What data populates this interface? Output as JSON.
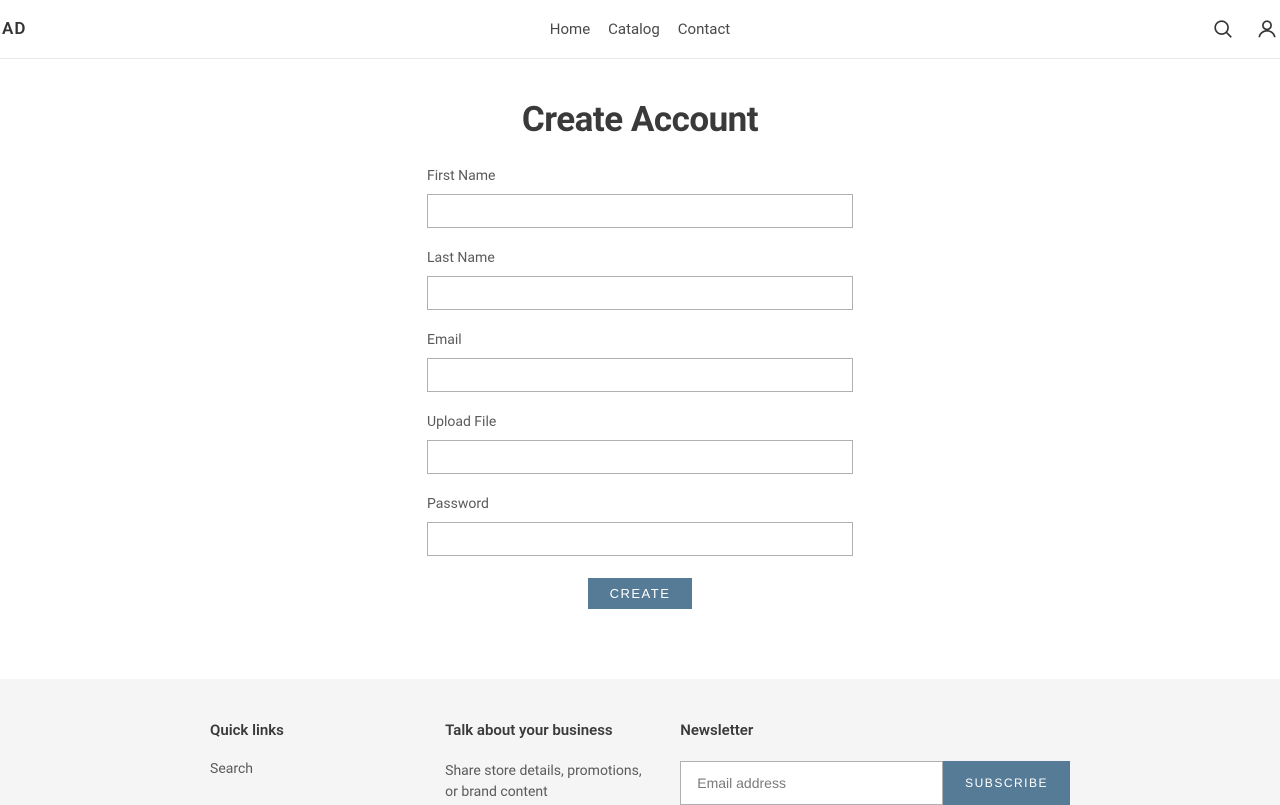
{
  "header": {
    "logo": "AD",
    "nav": [
      "Home",
      "Catalog",
      "Contact"
    ]
  },
  "page": {
    "title": "Create Account"
  },
  "form": {
    "fields": [
      {
        "label": "First Name"
      },
      {
        "label": "Last Name"
      },
      {
        "label": "Email"
      },
      {
        "label": "Upload File"
      },
      {
        "label": "Password"
      }
    ],
    "submit_label": "CREATE"
  },
  "footer": {
    "quick_links": {
      "heading": "Quick links",
      "items": [
        "Search"
      ]
    },
    "about": {
      "heading": "Talk about your business",
      "text": "Share store details, promotions, or brand content"
    },
    "newsletter": {
      "heading": "Newsletter",
      "placeholder": "Email address",
      "button": "SUBSCRIBE"
    }
  }
}
